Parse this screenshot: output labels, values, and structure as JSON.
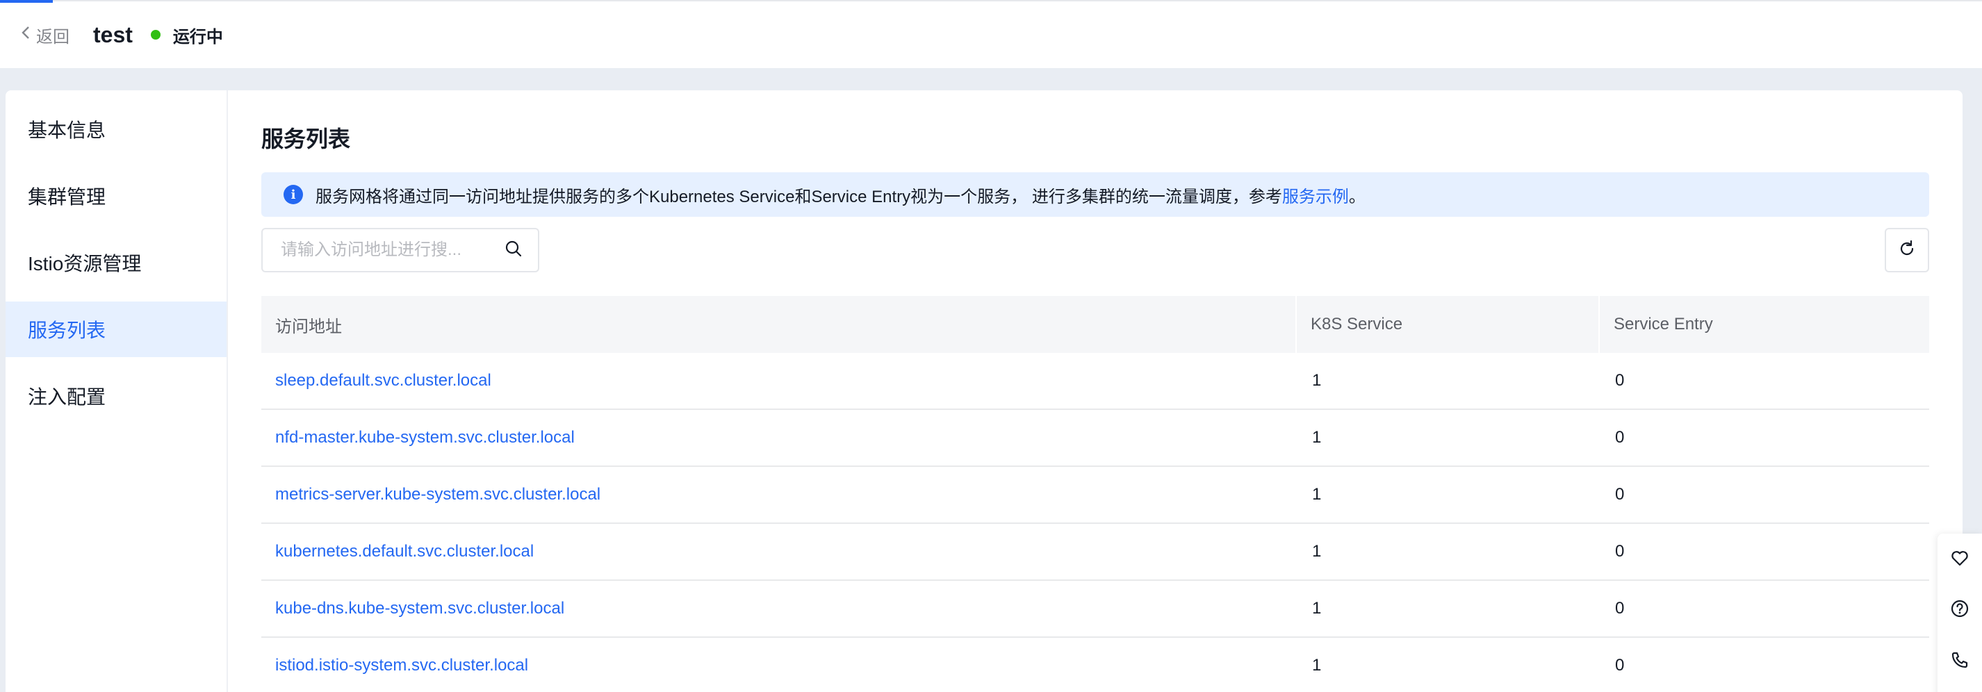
{
  "header": {
    "back_label": "返回",
    "title": "test",
    "status": "运行中",
    "status_color": "#30bf13"
  },
  "sidebar": {
    "items": [
      {
        "label": "基本信息",
        "active": false
      },
      {
        "label": "集群管理",
        "active": false
      },
      {
        "label": "Istio资源管理",
        "active": false
      },
      {
        "label": "服务列表",
        "active": true
      },
      {
        "label": "注入配置",
        "active": false
      }
    ]
  },
  "main": {
    "title": "服务列表",
    "alert": {
      "text": "服务网格将通过同一访问地址提供服务的多个Kubernetes Service和Service Entry视为一个服务， 进行多集群的统一流量调度，参考",
      "link": "服务示例",
      "suffix": "。"
    },
    "search": {
      "placeholder": "请输入访问地址进行搜...",
      "value": ""
    },
    "table": {
      "columns": [
        "访问地址",
        "K8S Service",
        "Service Entry"
      ],
      "rows": [
        {
          "address": "sleep.default.svc.cluster.local",
          "k8s": "1",
          "entry": "0"
        },
        {
          "address": "nfd-master.kube-system.svc.cluster.local",
          "k8s": "1",
          "entry": "0"
        },
        {
          "address": "metrics-server.kube-system.svc.cluster.local",
          "k8s": "1",
          "entry": "0"
        },
        {
          "address": "kubernetes.default.svc.cluster.local",
          "k8s": "1",
          "entry": "0"
        },
        {
          "address": "kube-dns.kube-system.svc.cluster.local",
          "k8s": "1",
          "entry": "0"
        },
        {
          "address": "istiod.istio-system.svc.cluster.local",
          "k8s": "1",
          "entry": "0"
        }
      ]
    }
  },
  "colors": {
    "accent": "#2468f2",
    "active_bg": "#e6f0ff",
    "page_bg": "#e9edf3"
  },
  "icons": {
    "back": "chevron-left-icon",
    "info": "info-icon",
    "search": "search-icon",
    "refresh": "refresh-icon",
    "favorite": "heart-icon",
    "help": "help-icon",
    "contact": "phone-icon"
  }
}
